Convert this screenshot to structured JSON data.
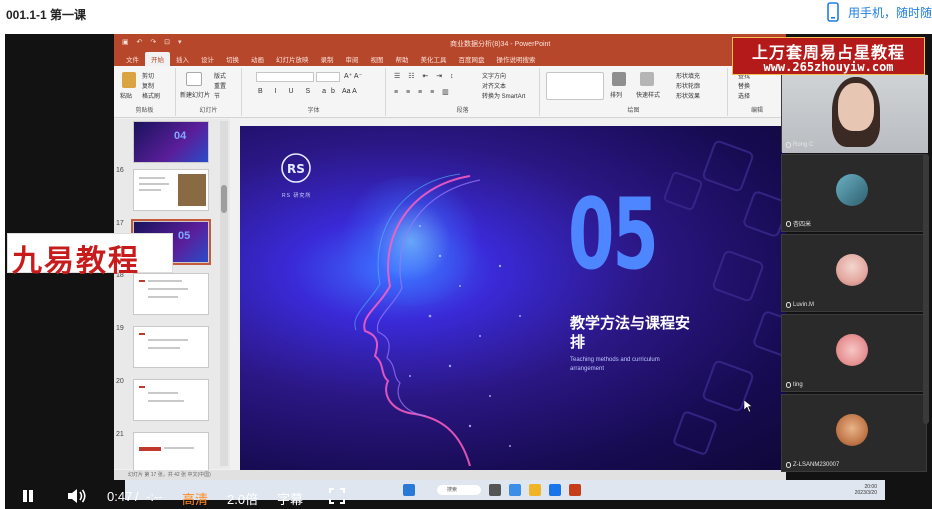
{
  "header": {
    "lesson_title": "001.1-1 第一课",
    "phone_link": "用手机，随时随"
  },
  "powerpoint": {
    "doc_title": "商业数据分析(8)34 - PowerPoint",
    "tabs": [
      "文件",
      "开始",
      "插入",
      "设计",
      "切换",
      "动画",
      "幻灯片放映",
      "录制",
      "审阅",
      "视图",
      "帮助",
      "美化工具",
      "百度网盘",
      "操作说明搜索"
    ],
    "ribbon_groups": [
      "剪贴板",
      "幻灯片",
      "字体",
      "段落",
      "绘图",
      "编辑"
    ],
    "ribbon_buttons": [
      "粘贴",
      "剪切",
      "复制",
      "格式刷",
      "新建幻灯片",
      "版式",
      "重置",
      "节",
      "文字方向",
      "对齐文本",
      "转换为 SmartArt",
      "排列",
      "快速样式",
      "形状填充",
      "形状轮廓",
      "形状效果",
      "查找",
      "替换",
      "选择"
    ],
    "status_text": "幻灯片 第 17 张，共 42 张    中文(中国)"
  },
  "thumbnails": [
    {
      "num": "",
      "label": "04"
    },
    {
      "num": "16",
      "label": ""
    },
    {
      "num": "17",
      "label": "05"
    },
    {
      "num": "18",
      "label": ""
    },
    {
      "num": "19",
      "label": ""
    },
    {
      "num": "20",
      "label": ""
    },
    {
      "num": "21",
      "label": ""
    }
  ],
  "slide": {
    "logo_text": "RS",
    "brand_text": "RS 研究所",
    "number": "05",
    "title_cn": "教学方法与课程安排",
    "subtitle_en": "Teaching methods and curriculum arrangement"
  },
  "watermarks": {
    "right_line1": "上万套周易占星教程",
    "right_line2": "www.265zhouyiw.com",
    "left": "九易教程"
  },
  "participants": [
    {
      "name": "Rong C"
    },
    {
      "name": "杏四米"
    },
    {
      "name": "Luvin.M"
    },
    {
      "name": "ting"
    },
    {
      "name": "Z-LSANM230007"
    }
  ],
  "taskbar": {
    "search_label": "搜索",
    "tray_time": "20:00",
    "tray_date": "2023/3/20"
  },
  "player": {
    "current_time": "0:47",
    "separator": "/",
    "total_time": "-:--",
    "quality": "高清",
    "speed": "2.0倍",
    "subtitles": "字幕"
  },
  "colors": {
    "ppt_accent": "#b7472a",
    "link_blue": "#1f7fe0",
    "quality_orange": "#ff8a22",
    "slide_number_blue": "#4d86ff",
    "watermark_red": "#b51a1a"
  },
  "icons": {
    "phone": "phone-icon",
    "pause": "pause-icon",
    "volume": "volume-icon",
    "fullscreen": "fullscreen-icon",
    "mic": "mic-icon"
  }
}
